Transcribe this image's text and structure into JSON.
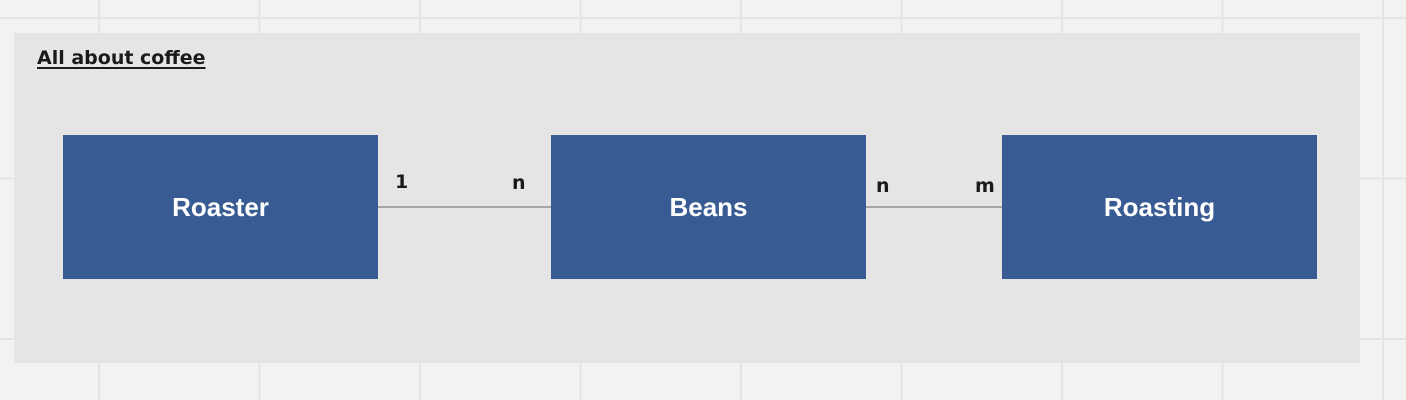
{
  "frame": {
    "title": "All about coffee"
  },
  "entities": [
    {
      "label": "Roaster"
    },
    {
      "label": "Beans"
    },
    {
      "label": "Roasting"
    }
  ],
  "relationships": [
    {
      "from": "Roaster",
      "to": "Beans",
      "from_cardinality": "1",
      "to_cardinality": "n"
    },
    {
      "from": "Beans",
      "to": "Roasting",
      "from_cardinality": "n",
      "to_cardinality": "m"
    }
  ],
  "colors": {
    "canvas": "#f2f2f2",
    "grid_line": "#e4e4e4",
    "frame_fill": "#e5e5e5",
    "entity_fill": "#395b93",
    "entity_text": "#ffffff",
    "connector": "#a6a6a6",
    "label_text": "#1a1a1a"
  }
}
